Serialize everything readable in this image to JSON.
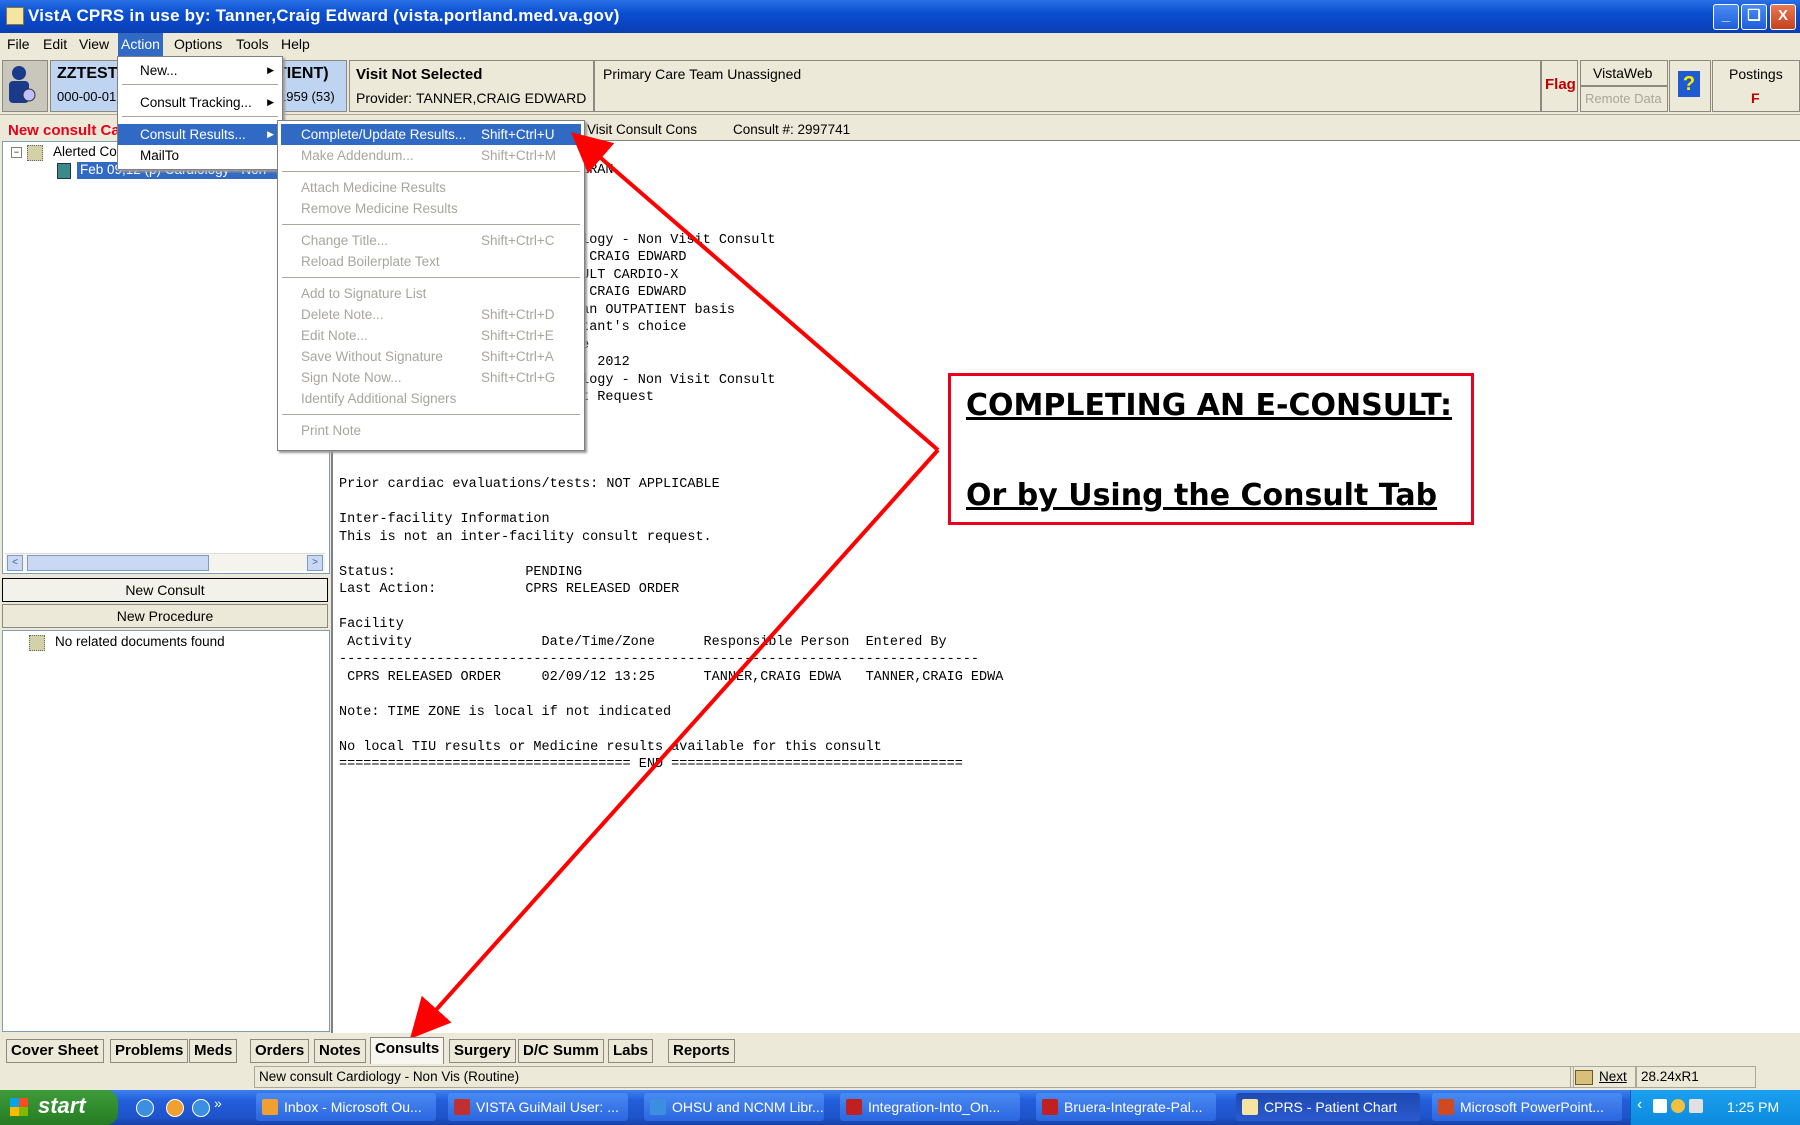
{
  "window": {
    "title": "VistA CPRS in use by: Tanner,Craig Edward  (vista.portland.med.va.gov)",
    "controls": [
      "_",
      "❏",
      "X"
    ]
  },
  "menubar": [
    "File",
    "Edit",
    "View",
    "Action",
    "Options",
    "Tools",
    "Help"
  ],
  "patient": {
    "name": "ZZTEST",
    "name_suffix": "TIENT)",
    "ssn": "000-00-01",
    "dob": "1959 (53)",
    "visit": "Visit Not Selected",
    "provider_label": "Provider:",
    "provider": "TANNER,CRAIG EDWARD",
    "team": "Primary Care Team Unassigned",
    "flag": "Flag",
    "vistaweb": "VistaWeb",
    "remote_data": "Remote Data",
    "help": "?",
    "postings": "Postings",
    "postings_code": "F"
  },
  "left_pane": {
    "header": "New consult Ca",
    "tree_root": "Alerted Co",
    "tree_item": "Feb 09,12  (p)  Cardiology - Non",
    "new_consult": "New Consult",
    "new_procedure": "New Procedure",
    "no_related": "No related documents found"
  },
  "consult_header": {
    "service": "Visit Consult Cons",
    "consult_no": "Consult #: 2997741"
  },
  "action_menu": {
    "items": [
      {
        "label": "New...",
        "arrow": "▶"
      },
      {
        "label": "Consult Tracking...",
        "arrow": "▶"
      },
      {
        "label": "Consult Results...",
        "arrow": "▶"
      },
      {
        "label": "MailTo",
        "arrow": ""
      }
    ]
  },
  "results_submenu": {
    "items": [
      {
        "label": "Complete/Update Results...",
        "shortcut": "Shift+Ctrl+U"
      },
      {
        "label": "Make Addendum...",
        "shortcut": "Shift+Ctrl+M"
      },
      {
        "label": "Attach Medicine Results",
        "shortcut": ""
      },
      {
        "label": "Remove Medicine Results",
        "shortcut": ""
      },
      {
        "label": "Change Title...",
        "shortcut": "Shift+Ctrl+C"
      },
      {
        "label": "Reload Boilerplate Text",
        "shortcut": ""
      },
      {
        "label": "Add to Signature List",
        "shortcut": ""
      },
      {
        "label": "Delete Note...",
        "shortcut": "Shift+Ctrl+D"
      },
      {
        "label": "Edit Note...",
        "shortcut": "Shift+Ctrl+E"
      },
      {
        "label": "Save Without Signature",
        "shortcut": "Shift+Ctrl+A"
      },
      {
        "label": "Sign Note Now...",
        "shortcut": "Shift+Ctrl+G"
      },
      {
        "label": "Identify Additional Signers",
        "shortcut": ""
      },
      {
        "label": "Print Note",
        "shortcut": ""
      }
    ]
  },
  "report_text_top": "ent\nTERAN\n\n\n\nology - Non Visit Consult\nR,CRAIG EDWARD\nSULT CARDIO-X\nR,CRAIG EDWARD\n an OUTPATIENT basis\nltant's choice\nne\n9, 2012\nology - Non Visit Consult\nlt Request",
  "report_text_bottom": "Prior cardiac evaluations/tests: NOT APPLICABLE\n\nInter-facility Information\nThis is not an inter-facility consult request.\n\nStatus:                PENDING\nLast Action:           CPRS RELEASED ORDER\n\nFacility\n Activity                Date/Time/Zone      Responsible Person  Entered By\n-------------------------------------------------------------------------------\n CPRS RELEASED ORDER     02/09/12 13:25      TANNER,CRAIG EDWA   TANNER,CRAIG EDWA\n\nNote: TIME ZONE is local if not indicated\n\nNo local TIU results or Medicine results available for this consult\n==================================== END ====================================",
  "callout": {
    "line1": "COMPLETING AN E-CONSULT:",
    "line2": "Or by Using the Consult Tab"
  },
  "tabs": [
    "Cover Sheet",
    "Problems",
    "Meds",
    "Orders",
    "Notes",
    "Consults",
    "Surgery",
    "D/C Summ",
    "Labs",
    "Reports"
  ],
  "statusbar": {
    "text": "New consult Cardiology - Non Vis (Routine)",
    "next": "Next",
    "version": "28.24xR1"
  },
  "taskbar": {
    "start": "start",
    "buttons": [
      "Inbox - Microsoft Ou...",
      "VISTA GuiMail  User: ...",
      "OHSU and NCNM Libr...",
      "Integration-Into_On...",
      "Bruera-Integrate-Pal...",
      "CPRS - Patient Chart",
      "Microsoft PowerPoint..."
    ],
    "clock": "1:25 PM"
  },
  "colors": {
    "accent": "#316ac5",
    "alert_red": "#e8001c",
    "annotation_red": "#ff0000"
  }
}
